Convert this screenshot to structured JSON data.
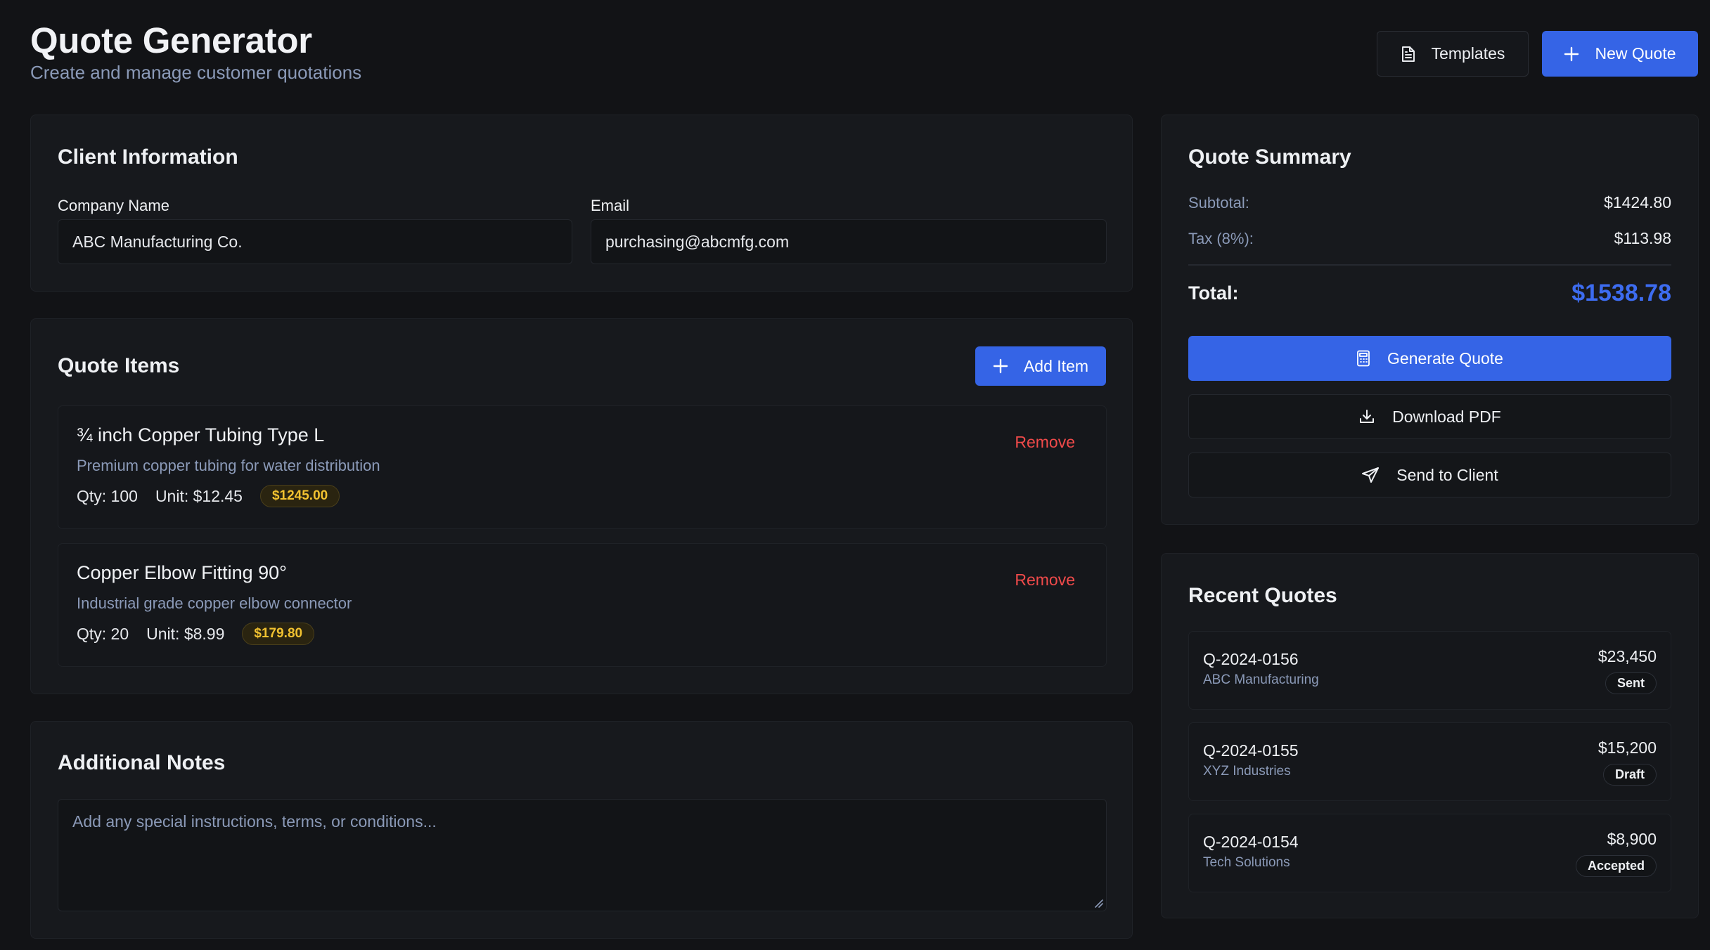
{
  "header": {
    "title": "Quote Generator",
    "subtitle": "Create and manage customer quotations",
    "templates_label": "Templates",
    "new_quote_label": "New Quote"
  },
  "client": {
    "title": "Client Information",
    "company_label": "Company Name",
    "company_value": "ABC Manufacturing Co.",
    "email_label": "Email",
    "email_value": "purchasing@abcmfg.com"
  },
  "items": {
    "title": "Quote Items",
    "add_label": "Add Item",
    "list": [
      {
        "name": "¾ inch Copper Tubing Type L",
        "description": "Premium copper tubing for water distribution",
        "qty": "Qty: 100",
        "unit": "Unit: $12.45",
        "total": "$1245.00",
        "remove": "Remove"
      },
      {
        "name": "Copper Elbow Fitting 90°",
        "description": "Industrial grade copper elbow connector",
        "qty": "Qty: 20",
        "unit": "Unit: $8.99",
        "total": "$179.80",
        "remove": "Remove"
      }
    ]
  },
  "notes": {
    "title": "Additional Notes",
    "placeholder": "Add any special instructions, terms, or conditions..."
  },
  "summary": {
    "title": "Quote Summary",
    "subtotal_label": "Subtotal:",
    "subtotal_value": "$1424.80",
    "tax_label": "Tax (8%):",
    "tax_value": "$113.98",
    "total_label": "Total:",
    "total_value": "$1538.78",
    "generate_label": "Generate Quote",
    "download_label": "Download PDF",
    "send_label": "Send to Client"
  },
  "recent": {
    "title": "Recent Quotes",
    "quotes": [
      {
        "id": "Q-2024-0156",
        "client": "ABC Manufacturing",
        "amount": "$23,450",
        "status": "Sent"
      },
      {
        "id": "Q-2024-0155",
        "client": "XYZ Industries",
        "amount": "$15,200",
        "status": "Draft"
      },
      {
        "id": "Q-2024-0154",
        "client": "Tech Solutions",
        "amount": "$8,900",
        "status": "Accepted"
      }
    ]
  },
  "icons": {
    "templates": "file-text-icon",
    "new_quote": "plus-icon",
    "add_item": "plus-icon",
    "generate": "calculator-icon",
    "download": "download-icon",
    "send": "send-icon"
  },
  "colors": {
    "background": "#121316",
    "card": "#17191d",
    "accent": "#3564e6",
    "total_accent": "#3d6cf0",
    "price_badge": "#f2c230",
    "remove": "#ef4a4a",
    "muted_text": "#8b9ab8"
  }
}
